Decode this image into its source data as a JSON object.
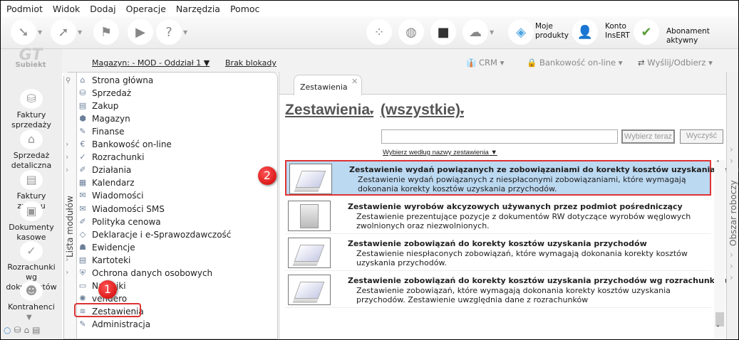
{
  "menu": [
    "Podmiot",
    "Widok",
    "Dodaj",
    "Operacje",
    "Narzędzia",
    "Pomoc"
  ],
  "toolbar": {
    "moje1": "Moje",
    "moje2": "produkty",
    "konto1": "Konto",
    "konto2": "InsERT",
    "konto_logo": "InsERT",
    "abonament": "Abonament aktywny"
  },
  "brand": "Subiekt",
  "left_buttons": [
    {
      "label": "Faktury sprzedaży",
      "icon": "coins-icon"
    },
    {
      "label": "Sprzedaż detaliczna",
      "icon": "basket-icon"
    },
    {
      "label": "Faktury zakupu",
      "icon": "documents-icon"
    },
    {
      "label": "Dokumenty kasowe",
      "icon": "cash-register-icon"
    },
    {
      "label": "Rozrachunki wg dokumentów",
      "icon": "check-docs-icon"
    },
    {
      "label": "Kontrahenci",
      "icon": "person-icon"
    }
  ],
  "topbar": {
    "magazyn": "Magazyn: - MOD - Oddział 1",
    "blokada": "Brak blokady",
    "crm": "CRM",
    "bank": "Bankowość on-line",
    "send": "Wyślij/Odbierz"
  },
  "modules_tab": "Lista modułów",
  "modules": [
    "Strona główna",
    "Sprzedaż",
    "Zakup",
    "Magazyn",
    "Finanse",
    "Bankowość on-line",
    "Rozrachunki",
    "Działania",
    "Kalendarz",
    "Wiadomości",
    "Wiadomości SMS",
    "Polityka cenowa",
    "Deklaracje i e-Sprawozdawczość",
    "Ewidencje",
    "Kartoteki",
    "Ochrona danych osobowych",
    "Naklejki",
    "vendero",
    "Zestawienia",
    "Administracja"
  ],
  "selected_module": "Zestawienia",
  "main": {
    "tab": "Zestawienia",
    "title": "Zestawienia",
    "filter": "(wszystkie)",
    "search_value": "",
    "btn_select": "Wybierz teraz",
    "btn_clear": "Wyczyść",
    "sort_link": "Wybierz według nazwy zestawienia",
    "rows": [
      {
        "title": "Zestawienie wydań powiązanych ze zobowiązaniami do korekty kosztów uzyskania przychodów",
        "desc": "Zestawienie wydań powiązanych z niespłaconymi zobowiązaniami, które wymagają dokonania korekty kosztów uzyskania przychodów."
      },
      {
        "title": "Zestawienie wyrobów akcyzowych używanych przez podmiot pośredniczący",
        "desc": "Zestawienie prezentujące pozycje z dokumentów RW dotyczące wyrobów węglowych zwolnionych oraz niezwolnionych."
      },
      {
        "title": "Zestawienie zobowiązań do korekty kosztów uzyskania przychodów",
        "desc": "Zestawienie niespłaconych zobowiązań, które wymagają dokonania korekty kosztów uzyskania przychodów."
      },
      {
        "title": "Zestawienie zobowiązań do korekty kosztów uzyskania przychodów wg rozrachunków",
        "desc": "Zestawienie zobowiązań, które wymagają dokonania korekty kosztów uzyskania przychodów. Zestawienie uwzględnia dane z rozrachunków"
      }
    ]
  },
  "workarea": "Obszar roboczy",
  "badges": [
    "1",
    "2"
  ],
  "colors": {
    "selected_row": "#bcd9f2",
    "highlight": "#dd3333"
  }
}
